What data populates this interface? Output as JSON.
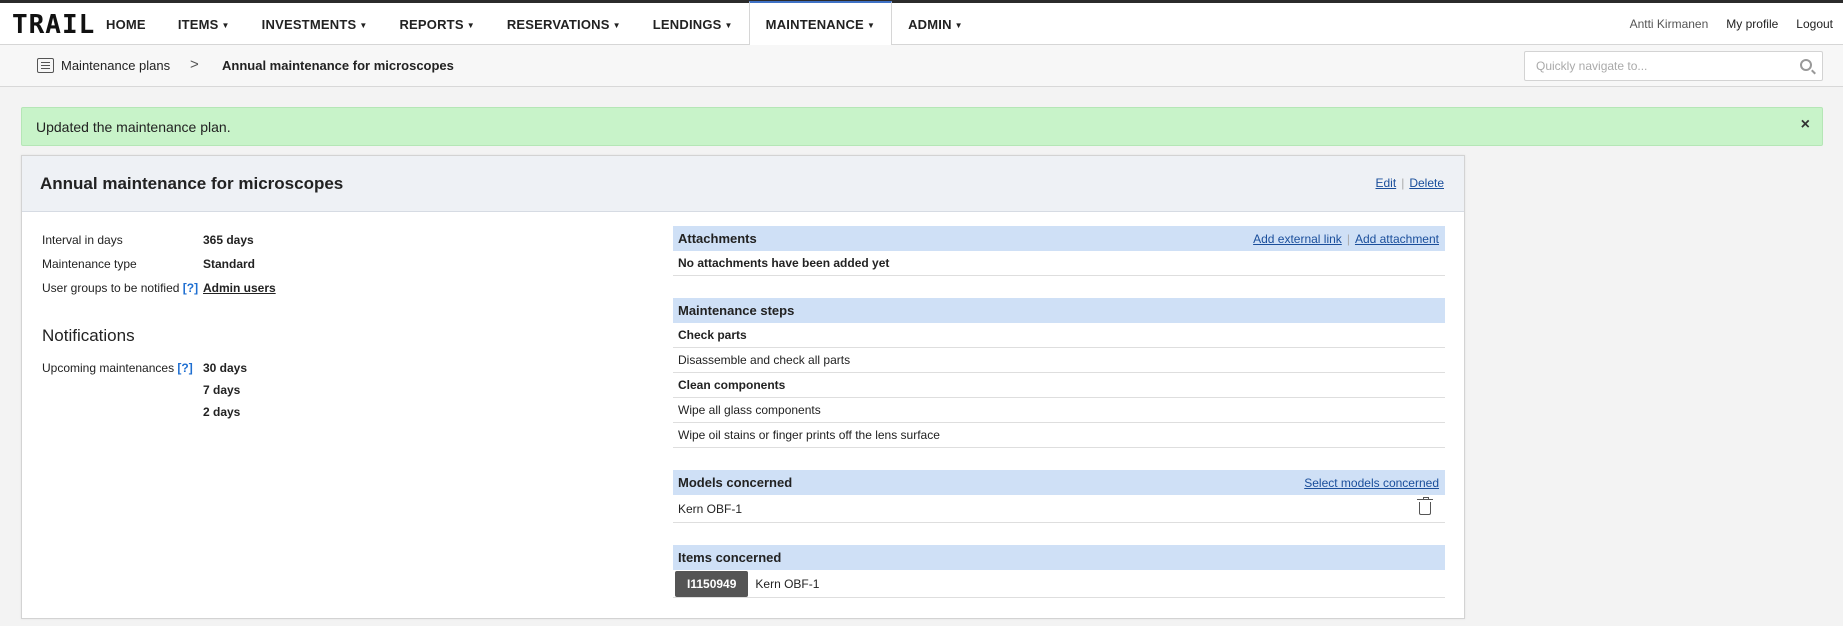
{
  "app": {
    "logo": "TRAIL"
  },
  "nav": {
    "items": [
      {
        "label": "HOME",
        "dropdown": false
      },
      {
        "label": "ITEMS",
        "dropdown": true
      },
      {
        "label": "INVESTMENTS",
        "dropdown": true
      },
      {
        "label": "REPORTS",
        "dropdown": true
      },
      {
        "label": "RESERVATIONS",
        "dropdown": true
      },
      {
        "label": "LENDINGS",
        "dropdown": true
      },
      {
        "label": "MAINTENANCE",
        "dropdown": true,
        "active": true
      },
      {
        "label": "ADMIN",
        "dropdown": true
      }
    ],
    "user": "Antti Kirmanen",
    "profile": "My profile",
    "logout": "Logout"
  },
  "breadcrumb": {
    "parent": "Maintenance plans",
    "separator": ">",
    "current": "Annual maintenance for microscopes"
  },
  "search": {
    "placeholder": "Quickly navigate to..."
  },
  "flash": {
    "message": "Updated the maintenance plan.",
    "close": "×"
  },
  "plan": {
    "title": "Annual maintenance for microscopes",
    "edit": "Edit",
    "separator": "|",
    "delete": "Delete",
    "fields": {
      "interval_label": "Interval in days",
      "interval_value": "365 days",
      "type_label": "Maintenance type",
      "type_value": "Standard",
      "groups_label": "User groups to be notified",
      "groups_help": "[?]",
      "groups_value": "Admin users"
    },
    "notifications": {
      "title": "Notifications",
      "upcoming_label": "Upcoming maintenances",
      "upcoming_help": "[?]",
      "values": [
        "30 days",
        "7 days",
        "2 days"
      ]
    }
  },
  "attachments": {
    "title": "Attachments",
    "add_link": "Add external link",
    "add_attachment": "Add attachment",
    "empty": "No attachments have been added yet"
  },
  "steps": {
    "title": "Maintenance steps",
    "rows": [
      {
        "text": "Check parts",
        "heading": true
      },
      {
        "text": "Disassemble and check all parts",
        "heading": false
      },
      {
        "text": "Clean components",
        "heading": true
      },
      {
        "text": "Wipe all glass components",
        "heading": false
      },
      {
        "text": "Wipe oil stains or finger prints off the lens surface",
        "heading": false
      }
    ]
  },
  "models": {
    "title": "Models concerned",
    "select": "Select models concerned",
    "rows": [
      {
        "name": "Kern OBF-1",
        "icon": "trash-icon"
      }
    ]
  },
  "items": {
    "title": "Items concerned",
    "rows": [
      {
        "code": "I1150949",
        "name": "Kern OBF-1"
      }
    ]
  },
  "colors": {
    "flash_bg": "#c8f3c9",
    "section_header_bg": "#cfe0f6",
    "link": "#1a4e9b",
    "active_tab_accent": "#3f72c6",
    "badge_bg": "#555555"
  }
}
